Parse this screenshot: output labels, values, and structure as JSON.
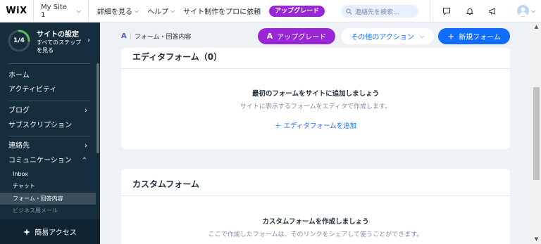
{
  "topbar": {
    "logo": "WiX",
    "site_name": "My Site 1",
    "nav": [
      "詳細を見る",
      "ヘルプ",
      "サイト制作をプロに依頼"
    ],
    "upgrade": "アップグレード",
    "search_placeholder": "連絡先を検索..."
  },
  "sidebar": {
    "setup": {
      "progress": "1/4",
      "progress_fraction": 0.25,
      "title": "サイトの設定",
      "subtitle_line1": "すべてのステップ",
      "subtitle_line2": "を見る"
    },
    "items": {
      "home": "ホーム",
      "activity": "アクティビティ",
      "blog": "ブログ",
      "subscriptions": "サブスクリプション",
      "contacts": "連絡先",
      "communication": "コミュニケーション"
    },
    "sub_items": {
      "inbox": "Inbox",
      "chat": "チャット",
      "forms": "フォーム・回答内容",
      "business_mail": "ビジネス用メール"
    },
    "quick_access": "簡易アクセス"
  },
  "main": {
    "breadcrumb": "フォーム・回答内容",
    "upgrade_button": "アップグレード",
    "more_actions": "その他のアクション",
    "new_form": "新規フォーム",
    "editor_card": {
      "title": "エディタフォーム（0）",
      "empty_title": "最初のフォームをサイトに追加しましょう",
      "empty_sub": "サイトに表示するフォームをエディタで作成します。",
      "add_link": "エディタフォームを追加"
    },
    "custom_card": {
      "title": "カスタムフォーム",
      "empty_title": "カスタムフォームを作成しましょう",
      "empty_sub": "ここで作成したフォームは、そのリンクをシェアして使うことができます。"
    }
  },
  "colors": {
    "accent": "#116dff",
    "upgrade": "#9a27d5",
    "sidebar": "#162d3d",
    "progress": "#60bc57"
  }
}
